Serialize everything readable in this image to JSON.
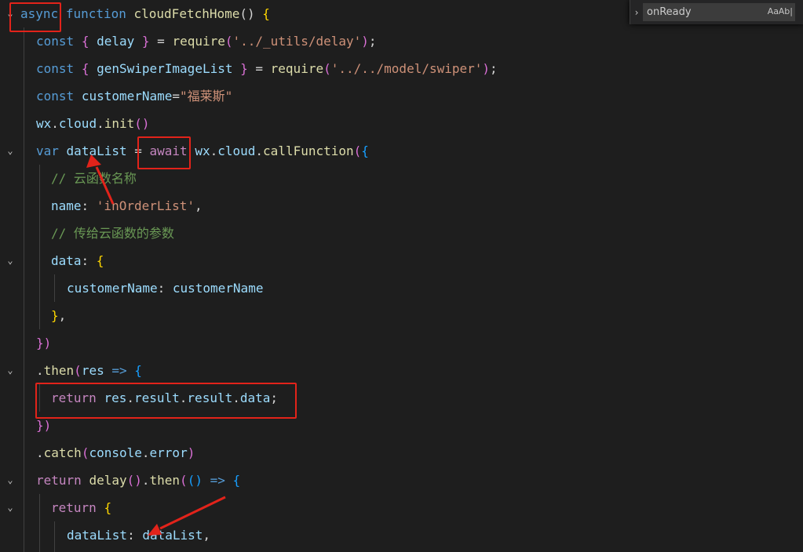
{
  "find_widget": {
    "query": "onReady",
    "match_case_label": "Aa",
    "match_word_label": "Ab|"
  },
  "code": {
    "lines": [
      [
        {
          "t": "async",
          "c": "tok-kw"
        },
        {
          "t": " ",
          "c": "tok-plain"
        },
        {
          "t": "function",
          "c": "tok-kw"
        },
        {
          "t": " ",
          "c": "tok-plain"
        },
        {
          "t": "cloudFetchHome",
          "c": "tok-fn"
        },
        {
          "t": "() ",
          "c": "tok-punc"
        },
        {
          "t": "{",
          "c": "tok-yb"
        }
      ],
      [
        {
          "t": "const",
          "c": "tok-kw"
        },
        {
          "t": " ",
          "c": "tok-plain"
        },
        {
          "t": "{",
          "c": "tok-pb"
        },
        {
          "t": " delay ",
          "c": "tok-var"
        },
        {
          "t": "}",
          "c": "tok-pb"
        },
        {
          "t": " = ",
          "c": "tok-plain"
        },
        {
          "t": "require",
          "c": "tok-fn"
        },
        {
          "t": "(",
          "c": "tok-pb"
        },
        {
          "t": "'../_utils/delay'",
          "c": "tok-str"
        },
        {
          "t": ")",
          "c": "tok-pb"
        },
        {
          "t": ";",
          "c": "tok-punc"
        }
      ],
      [
        {
          "t": "const",
          "c": "tok-kw"
        },
        {
          "t": " ",
          "c": "tok-plain"
        },
        {
          "t": "{",
          "c": "tok-pb"
        },
        {
          "t": " genSwiperImageList ",
          "c": "tok-var"
        },
        {
          "t": "}",
          "c": "tok-pb"
        },
        {
          "t": " = ",
          "c": "tok-plain"
        },
        {
          "t": "require",
          "c": "tok-fn"
        },
        {
          "t": "(",
          "c": "tok-pb"
        },
        {
          "t": "'../../model/swiper'",
          "c": "tok-str"
        },
        {
          "t": ")",
          "c": "tok-pb"
        },
        {
          "t": ";",
          "c": "tok-punc"
        }
      ],
      [
        {
          "t": "const",
          "c": "tok-kw"
        },
        {
          "t": " ",
          "c": "tok-plain"
        },
        {
          "t": "customerName",
          "c": "tok-var"
        },
        {
          "t": "=",
          "c": "tok-plain"
        },
        {
          "t": "\"福莱斯\"",
          "c": "tok-str"
        }
      ],
      [
        {
          "t": "wx",
          "c": "tok-var"
        },
        {
          "t": ".",
          "c": "tok-plain"
        },
        {
          "t": "cloud",
          "c": "tok-var"
        },
        {
          "t": ".",
          "c": "tok-plain"
        },
        {
          "t": "init",
          "c": "tok-fn"
        },
        {
          "t": "()",
          "c": "tok-pb"
        }
      ],
      [
        {
          "t": "var",
          "c": "tok-kw"
        },
        {
          "t": " ",
          "c": "tok-plain"
        },
        {
          "t": "dataList",
          "c": "tok-var"
        },
        {
          "t": " = ",
          "c": "tok-plain"
        },
        {
          "t": "await",
          "c": "tok-ctrl"
        },
        {
          "t": " ",
          "c": "tok-plain"
        },
        {
          "t": "wx",
          "c": "tok-var"
        },
        {
          "t": ".",
          "c": "tok-plain"
        },
        {
          "t": "cloud",
          "c": "tok-var"
        },
        {
          "t": ".",
          "c": "tok-plain"
        },
        {
          "t": "callFunction",
          "c": "tok-fn"
        },
        {
          "t": "(",
          "c": "tok-pb"
        },
        {
          "t": "{",
          "c": "tok-bb"
        }
      ],
      [
        {
          "t": "// 云函数名称",
          "c": "tok-cm"
        }
      ],
      [
        {
          "t": "name",
          "c": "tok-var"
        },
        {
          "t": ": ",
          "c": "tok-plain"
        },
        {
          "t": "'inOrderList'",
          "c": "tok-str"
        },
        {
          "t": ",",
          "c": "tok-punc"
        }
      ],
      [
        {
          "t": "// 传给云函数的参数",
          "c": "tok-cm"
        }
      ],
      [
        {
          "t": "data",
          "c": "tok-var"
        },
        {
          "t": ": ",
          "c": "tok-plain"
        },
        {
          "t": "{",
          "c": "tok-yb"
        }
      ],
      [
        {
          "t": "customerName",
          "c": "tok-var"
        },
        {
          "t": ": ",
          "c": "tok-plain"
        },
        {
          "t": "customerName",
          "c": "tok-var"
        }
      ],
      [
        {
          "t": "}",
          "c": "tok-yb"
        },
        {
          "t": ",",
          "c": "tok-punc"
        }
      ],
      [
        {
          "t": "})",
          "c": "tok-pb"
        }
      ],
      [
        {
          "t": ".",
          "c": "tok-plain"
        },
        {
          "t": "then",
          "c": "tok-fn"
        },
        {
          "t": "(",
          "c": "tok-pb"
        },
        {
          "t": "res",
          "c": "tok-var"
        },
        {
          "t": " ",
          "c": "tok-plain"
        },
        {
          "t": "=>",
          "c": "tok-kw"
        },
        {
          "t": " ",
          "c": "tok-plain"
        },
        {
          "t": "{",
          "c": "tok-bb"
        }
      ],
      [
        {
          "t": "return",
          "c": "tok-ctrl"
        },
        {
          "t": " ",
          "c": "tok-plain"
        },
        {
          "t": "res",
          "c": "tok-var"
        },
        {
          "t": ".",
          "c": "tok-plain"
        },
        {
          "t": "result",
          "c": "tok-var"
        },
        {
          "t": ".",
          "c": "tok-plain"
        },
        {
          "t": "result",
          "c": "tok-var"
        },
        {
          "t": ".",
          "c": "tok-plain"
        },
        {
          "t": "data",
          "c": "tok-var"
        },
        {
          "t": ";",
          "c": "tok-punc"
        }
      ],
      [
        {
          "t": "})",
          "c": "tok-pb"
        }
      ],
      [
        {
          "t": ".",
          "c": "tok-plain"
        },
        {
          "t": "catch",
          "c": "tok-fn"
        },
        {
          "t": "(",
          "c": "tok-pb"
        },
        {
          "t": "console",
          "c": "tok-var"
        },
        {
          "t": ".",
          "c": "tok-plain"
        },
        {
          "t": "error",
          "c": "tok-var"
        },
        {
          "t": ")",
          "c": "tok-pb"
        }
      ],
      [
        {
          "t": "return",
          "c": "tok-ctrl"
        },
        {
          "t": " ",
          "c": "tok-plain"
        },
        {
          "t": "delay",
          "c": "tok-fn"
        },
        {
          "t": "()",
          "c": "tok-pb"
        },
        {
          "t": ".",
          "c": "tok-plain"
        },
        {
          "t": "then",
          "c": "tok-fn"
        },
        {
          "t": "(",
          "c": "tok-pb"
        },
        {
          "t": "()",
          "c": "tok-bb"
        },
        {
          "t": " ",
          "c": "tok-plain"
        },
        {
          "t": "=>",
          "c": "tok-kw"
        },
        {
          "t": " ",
          "c": "tok-plain"
        },
        {
          "t": "{",
          "c": "tok-bb"
        }
      ],
      [
        {
          "t": "return",
          "c": "tok-ctrl"
        },
        {
          "t": " ",
          "c": "tok-plain"
        },
        {
          "t": "{",
          "c": "tok-yb"
        }
      ],
      [
        {
          "t": "dataList",
          "c": "tok-var"
        },
        {
          "t": ": ",
          "c": "tok-plain"
        },
        {
          "t": "dataList",
          "c": "tok-var"
        },
        {
          "t": ",",
          "c": "tok-punc"
        }
      ]
    ]
  }
}
